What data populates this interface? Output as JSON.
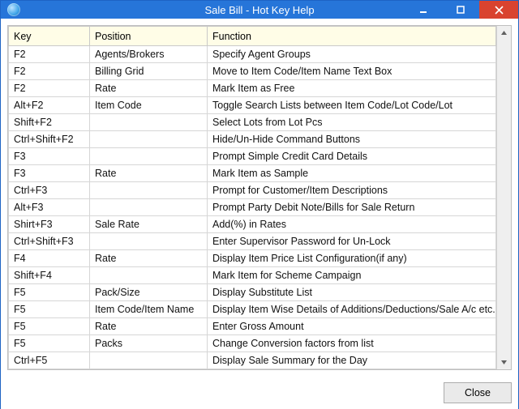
{
  "window": {
    "title": "Sale Bill - Hot Key Help"
  },
  "columns": {
    "key": "Key",
    "position": "Position",
    "function": "Function"
  },
  "rows": [
    {
      "key": "F2",
      "position": "Agents/Brokers",
      "function": "Specify Agent Groups"
    },
    {
      "key": "F2",
      "position": "Billing Grid",
      "function": "Move to Item Code/Item Name Text Box"
    },
    {
      "key": "F2",
      "position": "Rate",
      "function": "Mark Item as Free"
    },
    {
      "key": "Alt+F2",
      "position": "Item Code",
      "function": "Toggle Search Lists between Item Code/Lot Code/Lot"
    },
    {
      "key": "Shift+F2",
      "position": "",
      "function": "Select Lots from Lot Pcs"
    },
    {
      "key": "Ctrl+Shift+F2",
      "position": "",
      "function": "Hide/Un-Hide Command Buttons"
    },
    {
      "key": "F3",
      "position": "",
      "function": "Prompt Simple Credit Card Details"
    },
    {
      "key": "F3",
      "position": "Rate",
      "function": "Mark Item as Sample"
    },
    {
      "key": "Ctrl+F3",
      "position": "",
      "function": "Prompt for Customer/Item Descriptions"
    },
    {
      "key": "Alt+F3",
      "position": "",
      "function": "Prompt Party Debit Note/Bills for Sale Return"
    },
    {
      "key": "Shirt+F3",
      "position": "Sale Rate",
      "function": "Add(%) in Rates"
    },
    {
      "key": "Ctrl+Shift+F3",
      "position": "",
      "function": "Enter Supervisor Password for Un-Lock"
    },
    {
      "key": "F4",
      "position": "Rate",
      "function": "Display Item Price List Configuration(if any)"
    },
    {
      "key": "Shift+F4",
      "position": "",
      "function": "Mark Item for Scheme Campaign"
    },
    {
      "key": "F5",
      "position": "Pack/Size",
      "function": "Display Substitute List"
    },
    {
      "key": "F5",
      "position": "Item Code/Item Name",
      "function": "Display Item Wise Details of Additions/Deductions/Sale A/c etc."
    },
    {
      "key": "F5",
      "position": "Rate",
      "function": "Enter Gross Amount"
    },
    {
      "key": "F5",
      "position": "Packs",
      "function": "Change Conversion factors from list"
    },
    {
      "key": "Ctrl+F5",
      "position": "",
      "function": "Display Sale Summary for the Day"
    }
  ],
  "buttons": {
    "close": "Close"
  }
}
